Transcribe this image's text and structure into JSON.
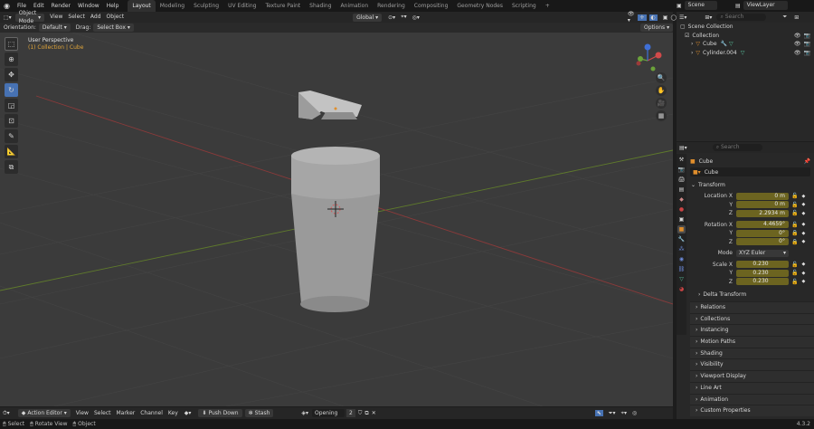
{
  "topbar": {
    "menus": [
      "File",
      "Edit",
      "Render",
      "Window",
      "Help"
    ],
    "workspaces": [
      "Layout",
      "Modeling",
      "Sculpting",
      "UV Editing",
      "Texture Paint",
      "Shading",
      "Animation",
      "Rendering",
      "Compositing",
      "Geometry Nodes",
      "Scripting"
    ],
    "active_workspace": "Layout",
    "add_tab": "+",
    "scene": "Scene",
    "view_layer": "ViewLayer"
  },
  "viewport_header": {
    "mode": "Object Mode",
    "menus": [
      "View",
      "Select",
      "Add",
      "Object"
    ],
    "transform_orientation": "Global",
    "orientation_label": "Orientation:",
    "orientation_value": "Default",
    "drag_label": "Drag:",
    "drag_value": "Select Box",
    "options": "Options"
  },
  "viewport": {
    "perspective": "User Perspective",
    "collection_info": "(1) Collection | Cube"
  },
  "outliner": {
    "search_placeholder": "Search",
    "root": "Scene Collection",
    "collection": "Collection",
    "items": [
      "Cube",
      "Cylinder.004"
    ]
  },
  "properties": {
    "search_placeholder": "Search",
    "object_name": "Cube",
    "data_name": "Cube",
    "transform_title": "Transform",
    "location": {
      "label": "Location X",
      "x": "0 m",
      "y": "0 m",
      "z": "2.2934 m"
    },
    "rotation": {
      "label": "Rotation X",
      "x": "4.4659°",
      "y": "0°",
      "z": "0°"
    },
    "mode_label": "Mode",
    "mode_value": "XYZ Euler",
    "scale": {
      "label": "Scale X",
      "x": "0.230",
      "y": "0.230",
      "z": "0.230"
    },
    "axis_y": "Y",
    "axis_z": "Z",
    "delta": "Delta Transform",
    "panels": [
      "Relations",
      "Collections",
      "Instancing",
      "Motion Paths",
      "Shading",
      "Visibility",
      "Viewport Display",
      "Line Art",
      "Animation",
      "Custom Properties"
    ]
  },
  "timeline": {
    "editor": "Action Editor",
    "menus": [
      "View",
      "Select",
      "Marker",
      "Channel",
      "Key"
    ],
    "push_down": "Push Down",
    "stash": "Stash",
    "action": "Opening",
    "users": "2"
  },
  "statusbar": {
    "select": "Select",
    "rotate": "Rotate View",
    "object": "Object",
    "version": "4.3.2"
  },
  "colors": {
    "accent": "#4772b3",
    "field": "#6c6420",
    "grid_x": "#8a3a3a",
    "grid_y": "#5f7a2c"
  }
}
